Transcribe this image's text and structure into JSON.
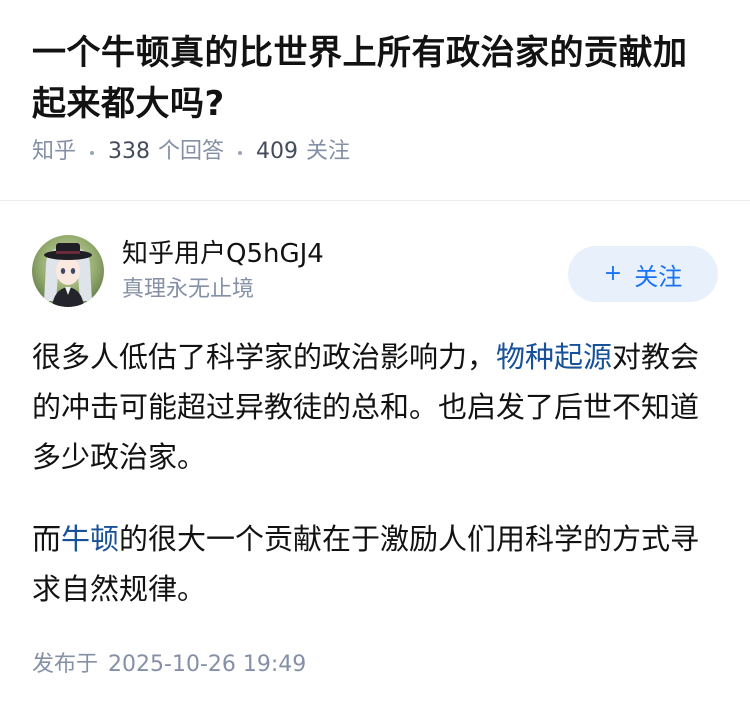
{
  "question": {
    "title": "一个牛顿真的比世界上所有政治家的贡献加起来都大吗?",
    "source": "知乎",
    "answer_count": "338",
    "answer_label": "个回答",
    "follower_count": "409",
    "follower_label": "关注"
  },
  "author": {
    "name": "知乎用户Q5hGJ4",
    "bio": "真理永无止境",
    "follow_label": "关注",
    "follow_icon": "plus-icon"
  },
  "answer": {
    "p1_before": "很多人低估了科学家的政治影响力，",
    "p1_link": "物种起源",
    "p1_after": "对教会的冲击可能超过异教徒的总和。也启发了后世不知道多少政治家。",
    "p2_before": "而",
    "p2_link": "牛顿",
    "p2_after": "的很大一个贡献在于激励人们用科学的方式寻求自然规律。"
  },
  "footer": {
    "publish_label": "发布于",
    "publish_time": "2025-10-26 19:49"
  },
  "colors": {
    "link": "#175199",
    "accent": "#1772f6",
    "meta": "#8590a6",
    "follow_bg": "#e8f1fb"
  }
}
